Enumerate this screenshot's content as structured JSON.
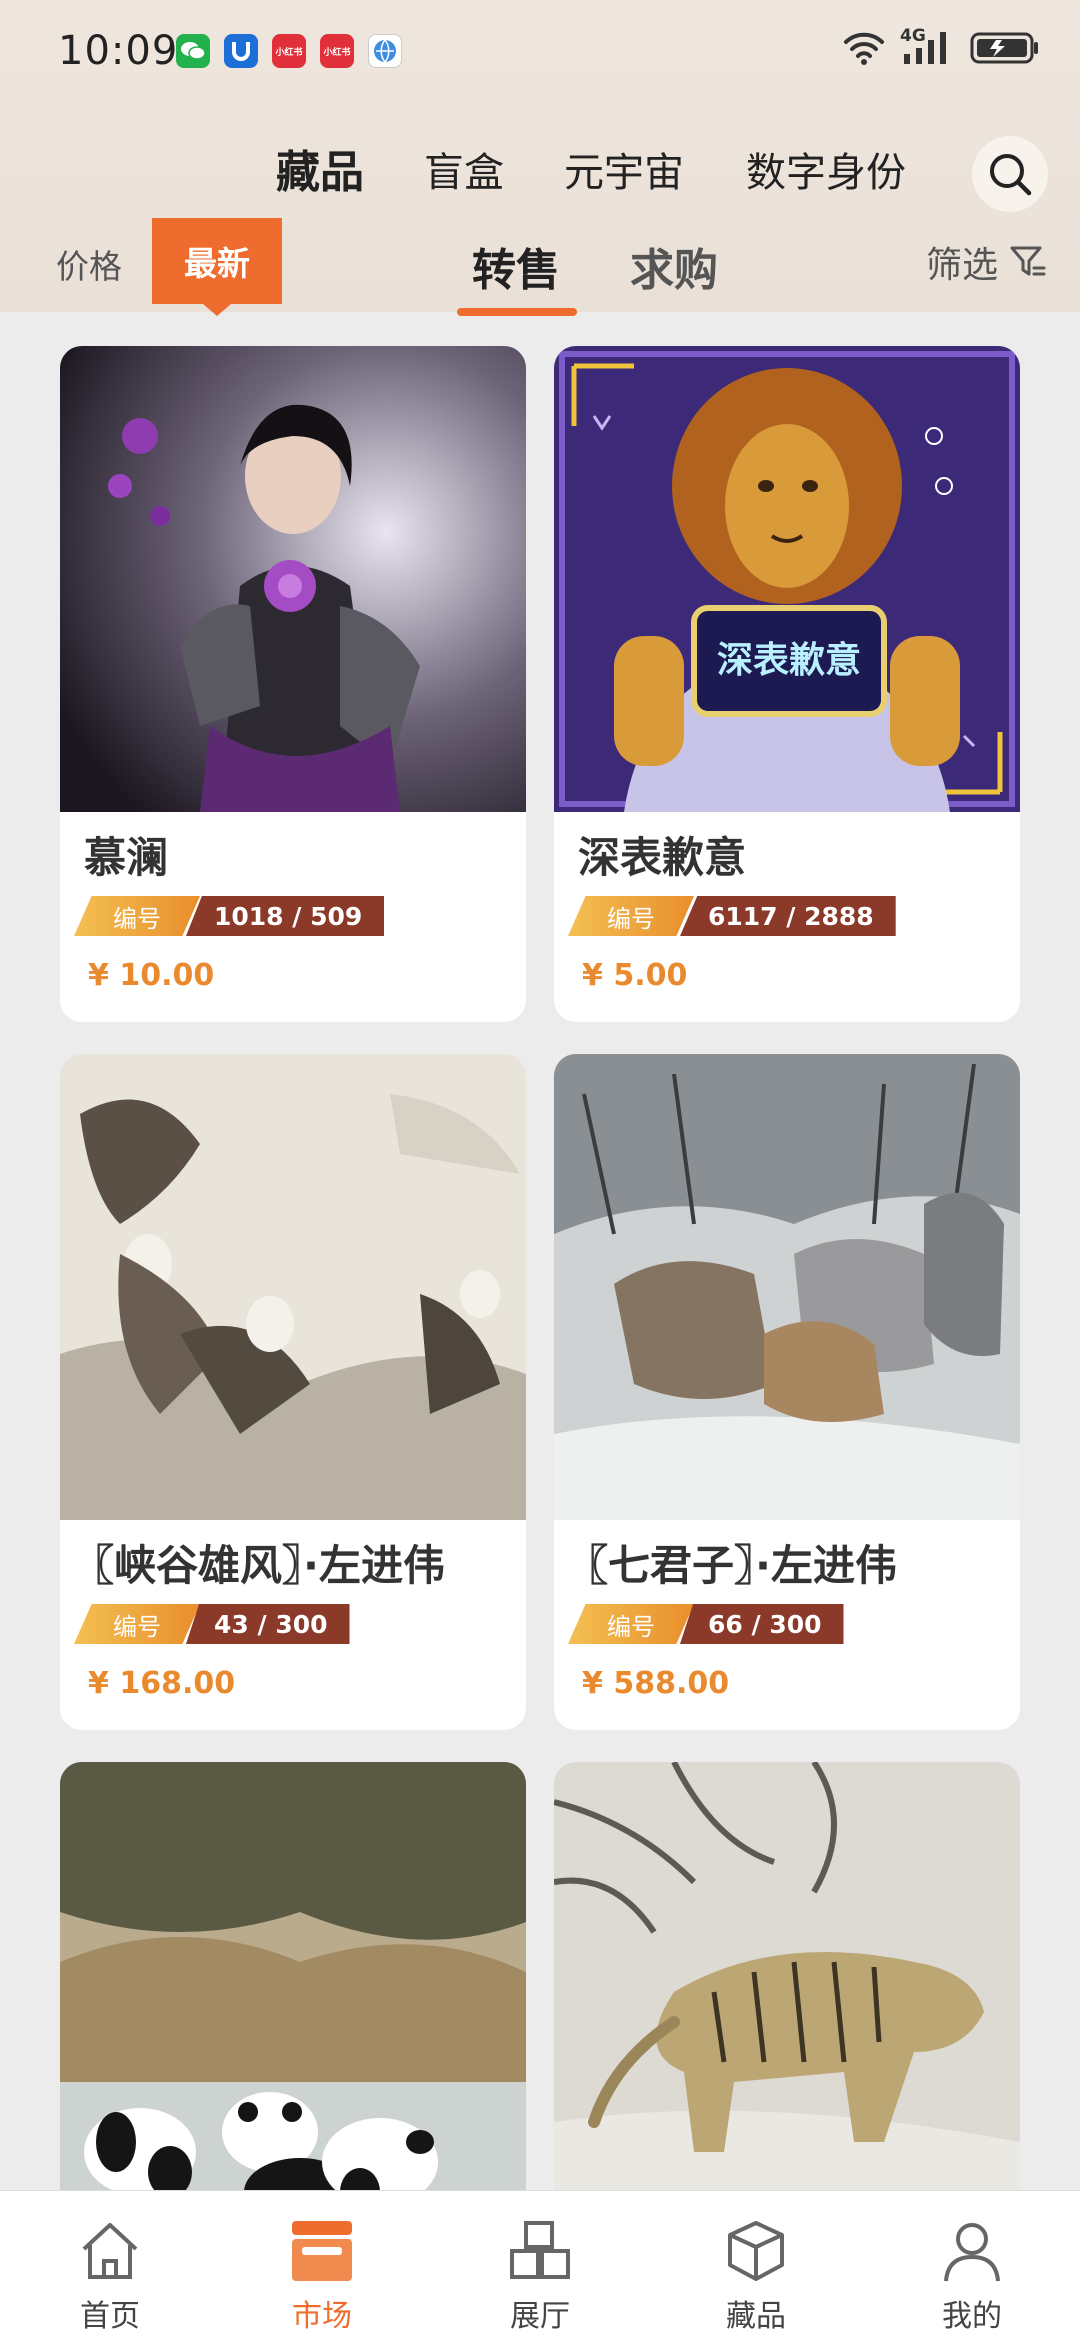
{
  "status_bar": {
    "time": "10:09",
    "notifications": [
      {
        "name": "wechat-icon",
        "color": "#22b14c",
        "text": ""
      },
      {
        "name": "app-u-icon",
        "color": "#1b6fd6",
        "text": "U"
      },
      {
        "name": "xiaohongshu-icon-1",
        "color": "#e2303a",
        "text": "小红书"
      },
      {
        "name": "xiaohongshu-icon-2",
        "color": "#e2303a",
        "text": "小红书"
      },
      {
        "name": "browser-icon",
        "color": "#3d8de0",
        "text": ""
      }
    ],
    "network": "4G"
  },
  "category_tabs": [
    {
      "label": "藏品",
      "active": true
    },
    {
      "label": "盲盒",
      "active": false
    },
    {
      "label": "元宇宙",
      "active": false
    },
    {
      "label": "数字身份",
      "active": false
    }
  ],
  "sort": {
    "price_label": "价格",
    "latest_label": "最新"
  },
  "mode_tabs": [
    {
      "label": "转售",
      "active": true
    },
    {
      "label": "求购",
      "active": false
    }
  ],
  "filter_label": "筛选",
  "badge_label": "编号",
  "cards": [
    {
      "name": "慕澜",
      "number": "1018 / 509",
      "price": "¥ 10.00",
      "art": "armored-girl"
    },
    {
      "name": "深表歉意",
      "number": "6117 / 2888",
      "price": "¥ 5.00",
      "art": "lion-sign"
    },
    {
      "name": "〖峡谷雄风〗·左进伟",
      "number": "43 / 300",
      "price": "¥ 168.00",
      "art": "eagles"
    },
    {
      "name": "〖七君子〗·左进伟",
      "number": "66 / 300",
      "price": "¥ 588.00",
      "art": "wolves"
    },
    {
      "name": "",
      "number": "",
      "price": "",
      "art": "pandas"
    },
    {
      "name": "",
      "number": "",
      "price": "",
      "art": "tiger"
    }
  ],
  "lion_sign_text": "深表歉意",
  "bottom_nav": [
    {
      "label": "首页",
      "icon": "home-icon",
      "active": false
    },
    {
      "label": "市场",
      "icon": "shop-icon",
      "active": true
    },
    {
      "label": "展厅",
      "icon": "gallery-icon",
      "active": false
    },
    {
      "label": "藏品",
      "icon": "cube-icon",
      "active": false
    },
    {
      "label": "我的",
      "icon": "profile-icon",
      "active": false
    }
  ],
  "colors": {
    "accent": "#ee6d2e",
    "badge_dark": "#8b3a2a",
    "price": "#e98a2e"
  }
}
